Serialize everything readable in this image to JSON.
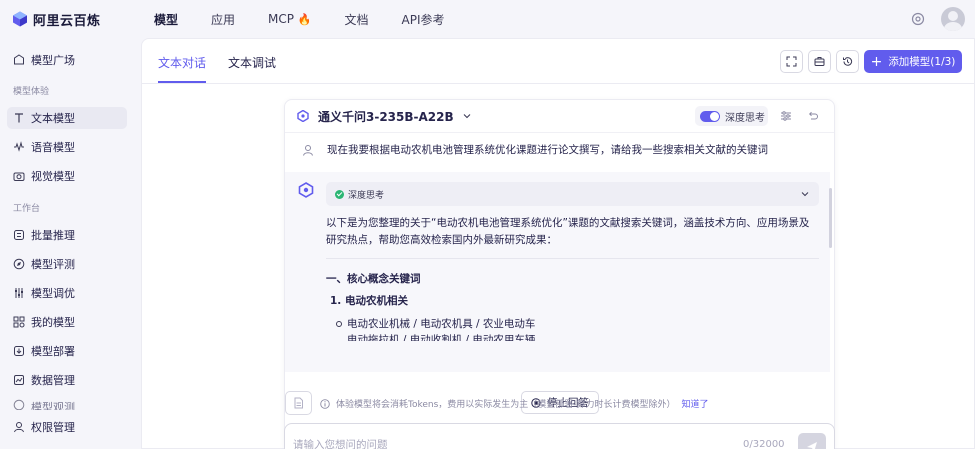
{
  "brand": {
    "name": "阿里云百炼"
  },
  "topnav": {
    "items": [
      {
        "label": "模型"
      },
      {
        "label": "应用"
      },
      {
        "label": "MCP",
        "badge": "🔥"
      },
      {
        "label": "文档"
      },
      {
        "label": "API参考"
      }
    ],
    "active": "模型"
  },
  "sidebar": {
    "top_item": {
      "label": "模型广场",
      "icon": "plaza-icon"
    },
    "section1": "模型体验",
    "section1_items": [
      {
        "label": "文本模型",
        "icon": "text-icon",
        "active": true
      },
      {
        "label": "语音模型",
        "icon": "waveform-icon"
      },
      {
        "label": "视觉模型",
        "icon": "camera-icon"
      }
    ],
    "section2": "工作台",
    "section2_items": [
      {
        "label": "批量推理",
        "icon": "batch-icon"
      },
      {
        "label": "模型评测",
        "icon": "compass-icon"
      },
      {
        "label": "模型调优",
        "icon": "sliders-icon"
      },
      {
        "label": "我的模型",
        "icon": "grid-icon"
      },
      {
        "label": "模型部署",
        "icon": "deploy-icon"
      },
      {
        "label": "数据管理",
        "icon": "chart-icon"
      },
      {
        "label": "模型观测",
        "icon": "monitor-icon"
      },
      {
        "label": "权限管理",
        "icon": "user-icon"
      }
    ]
  },
  "tabs": {
    "items": [
      "文本对话",
      "文本调试"
    ],
    "active": "文本对话"
  },
  "toolbar": {
    "add_model": "添加模型(1/3)"
  },
  "chat": {
    "model_name": "通义千问3-235B-A22B",
    "deep_think_label": "深度思考",
    "deep_think_enabled": true,
    "user_message": "现在我要根据电动农机电池管理系统优化课题进行论文撰写，请给我一些搜索相关文献的关键词",
    "thinking_label": "深度思考",
    "answer_intro": "以下是为您整理的关于“电动农机电池管理系统优化”课题的文献搜索关键词，涵盖技术方向、应用场景及研究热点，帮助您高效检索国内外最新研究成果：",
    "section_title": "一、核心概念关键词",
    "subsection_title": "1.  电动农机相关",
    "list_items": [
      "电动农业机械 / 电动农机具 / 农业电动车",
      "电动拖拉机 / 电动收割机 / 电动农用车辆"
    ]
  },
  "stop_button": "停止回答",
  "notice": {
    "text": "体验模型将会消耗Tokens，费用以实际发生为主（模型部署-算力时长计费模型除外）",
    "link": "知道了"
  },
  "input": {
    "placeholder": "请输入您想问的问题",
    "counter": "0/32000"
  },
  "colors": {
    "accent": "#615ced",
    "success": "#2bb673"
  }
}
